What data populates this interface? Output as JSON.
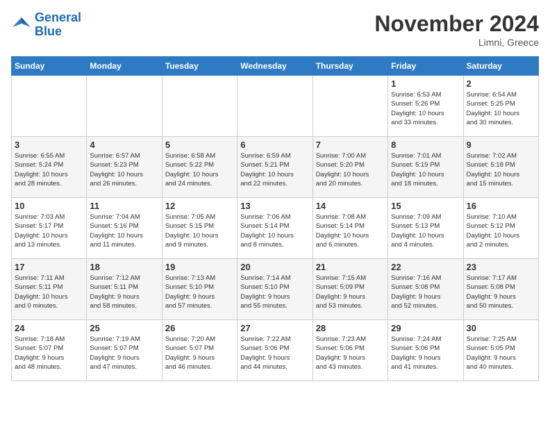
{
  "header": {
    "logo_line1": "General",
    "logo_line2": "Blue",
    "month_title": "November 2024",
    "subtitle": "Limni, Greece"
  },
  "weekdays": [
    "Sunday",
    "Monday",
    "Tuesday",
    "Wednesday",
    "Thursday",
    "Friday",
    "Saturday"
  ],
  "weeks": [
    [
      {
        "day": "",
        "info": ""
      },
      {
        "day": "",
        "info": ""
      },
      {
        "day": "",
        "info": ""
      },
      {
        "day": "",
        "info": ""
      },
      {
        "day": "",
        "info": ""
      },
      {
        "day": "1",
        "info": "Sunrise: 6:53 AM\nSunset: 5:26 PM\nDaylight: 10 hours\nand 33 minutes."
      },
      {
        "day": "2",
        "info": "Sunrise: 6:54 AM\nSunset: 5:25 PM\nDaylight: 10 hours\nand 30 minutes."
      }
    ],
    [
      {
        "day": "3",
        "info": "Sunrise: 6:55 AM\nSunset: 5:24 PM\nDaylight: 10 hours\nand 28 minutes."
      },
      {
        "day": "4",
        "info": "Sunrise: 6:57 AM\nSunset: 5:23 PM\nDaylight: 10 hours\nand 26 minutes."
      },
      {
        "day": "5",
        "info": "Sunrise: 6:58 AM\nSunset: 5:22 PM\nDaylight: 10 hours\nand 24 minutes."
      },
      {
        "day": "6",
        "info": "Sunrise: 6:59 AM\nSunset: 5:21 PM\nDaylight: 10 hours\nand 22 minutes."
      },
      {
        "day": "7",
        "info": "Sunrise: 7:00 AM\nSunset: 5:20 PM\nDaylight: 10 hours\nand 20 minutes."
      },
      {
        "day": "8",
        "info": "Sunrise: 7:01 AM\nSunset: 5:19 PM\nDaylight: 10 hours\nand 18 minutes."
      },
      {
        "day": "9",
        "info": "Sunrise: 7:02 AM\nSunset: 5:18 PM\nDaylight: 10 hours\nand 15 minutes."
      }
    ],
    [
      {
        "day": "10",
        "info": "Sunrise: 7:03 AM\nSunset: 5:17 PM\nDaylight: 10 hours\nand 13 minutes."
      },
      {
        "day": "11",
        "info": "Sunrise: 7:04 AM\nSunset: 5:16 PM\nDaylight: 10 hours\nand 11 minutes."
      },
      {
        "day": "12",
        "info": "Sunrise: 7:05 AM\nSunset: 5:15 PM\nDaylight: 10 hours\nand 9 minutes."
      },
      {
        "day": "13",
        "info": "Sunrise: 7:06 AM\nSunset: 5:14 PM\nDaylight: 10 hours\nand 8 minutes."
      },
      {
        "day": "14",
        "info": "Sunrise: 7:08 AM\nSunset: 5:14 PM\nDaylight: 10 hours\nand 6 minutes."
      },
      {
        "day": "15",
        "info": "Sunrise: 7:09 AM\nSunset: 5:13 PM\nDaylight: 10 hours\nand 4 minutes."
      },
      {
        "day": "16",
        "info": "Sunrise: 7:10 AM\nSunset: 5:12 PM\nDaylight: 10 hours\nand 2 minutes."
      }
    ],
    [
      {
        "day": "17",
        "info": "Sunrise: 7:11 AM\nSunset: 5:11 PM\nDaylight: 10 hours\nand 0 minutes."
      },
      {
        "day": "18",
        "info": "Sunrise: 7:12 AM\nSunset: 5:11 PM\nDaylight: 9 hours\nand 58 minutes."
      },
      {
        "day": "19",
        "info": "Sunrise: 7:13 AM\nSunset: 5:10 PM\nDaylight: 9 hours\nand 57 minutes."
      },
      {
        "day": "20",
        "info": "Sunrise: 7:14 AM\nSunset: 5:10 PM\nDaylight: 9 hours\nand 55 minutes."
      },
      {
        "day": "21",
        "info": "Sunrise: 7:15 AM\nSunset: 5:09 PM\nDaylight: 9 hours\nand 53 minutes."
      },
      {
        "day": "22",
        "info": "Sunrise: 7:16 AM\nSunset: 5:08 PM\nDaylight: 9 hours\nand 52 minutes."
      },
      {
        "day": "23",
        "info": "Sunrise: 7:17 AM\nSunset: 5:08 PM\nDaylight: 9 hours\nand 50 minutes."
      }
    ],
    [
      {
        "day": "24",
        "info": "Sunrise: 7:18 AM\nSunset: 5:07 PM\nDaylight: 9 hours\nand 48 minutes."
      },
      {
        "day": "25",
        "info": "Sunrise: 7:19 AM\nSunset: 5:07 PM\nDaylight: 9 hours\nand 47 minutes."
      },
      {
        "day": "26",
        "info": "Sunrise: 7:20 AM\nSunset: 5:07 PM\nDaylight: 9 hours\nand 46 minutes."
      },
      {
        "day": "27",
        "info": "Sunrise: 7:22 AM\nSunset: 5:06 PM\nDaylight: 9 hours\nand 44 minutes."
      },
      {
        "day": "28",
        "info": "Sunrise: 7:23 AM\nSunset: 5:06 PM\nDaylight: 9 hours\nand 43 minutes."
      },
      {
        "day": "29",
        "info": "Sunrise: 7:24 AM\nSunset: 5:06 PM\nDaylight: 9 hours\nand 41 minutes."
      },
      {
        "day": "30",
        "info": "Sunrise: 7:25 AM\nSunset: 5:05 PM\nDaylight: 9 hours\nand 40 minutes."
      }
    ]
  ]
}
